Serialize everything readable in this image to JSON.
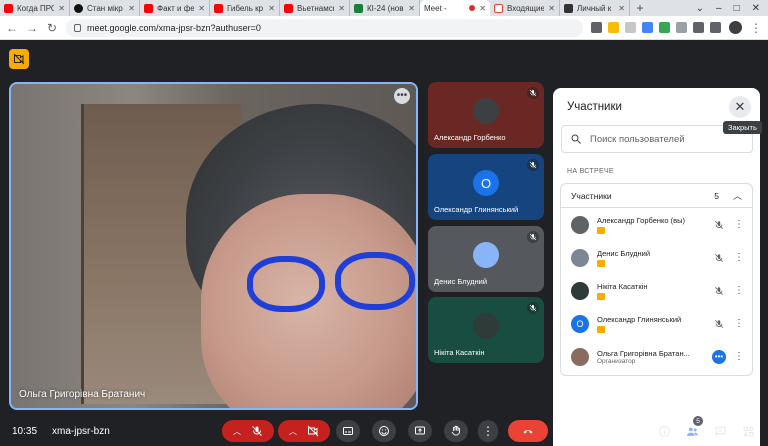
{
  "browser": {
    "tabs": [
      {
        "title": "Когда ПРО",
        "icon": "youtube-icon"
      },
      {
        "title": "Стан мікр",
        "icon": "github-icon"
      },
      {
        "title": "Факт и фе",
        "icon": "youtube-icon"
      },
      {
        "title": "Гибель кр",
        "icon": "youtube-icon"
      },
      {
        "title": "Вьетнамск",
        "icon": "youtube-icon"
      },
      {
        "title": "КІ-24 (нов",
        "icon": "sheets-icon"
      },
      {
        "title": "Meet -",
        "icon": "meet-icon",
        "active": true
      },
      {
        "title": "Входящие",
        "icon": "gmail-icon"
      },
      {
        "title": "Личный к",
        "icon": "notion-icon"
      }
    ],
    "url": "meet.google.com/xma-jpsr-bzn?authuser=0"
  },
  "main_tile": {
    "name": "Ольга Григорівна Братанич"
  },
  "side_tiles": [
    {
      "name": "Александр Горбенко",
      "avatar_letter": ""
    },
    {
      "name": "Олександр Глинянський",
      "avatar_letter": "O"
    },
    {
      "name": "Денис Блудний",
      "avatar_letter": ""
    },
    {
      "name": "Нікіта Касаткін",
      "avatar_letter": ""
    }
  ],
  "panel": {
    "title": "Участники",
    "close_tooltip": "Закрыть",
    "search_placeholder": "Поиск пользователей",
    "section_label": "НА ВСТРЕЧЕ",
    "group_label": "Участники",
    "group_count": "5",
    "participants": [
      {
        "name": "Александр Горбенко (вы)",
        "sub": "",
        "avatar_color": "#5f6368",
        "letter": ""
      },
      {
        "name": "Денис Блудний",
        "sub": "",
        "avatar_color": "#7b8794",
        "letter": ""
      },
      {
        "name": "Нікіта Касаткін",
        "sub": "",
        "avatar_color": "#2e3b38",
        "letter": ""
      },
      {
        "name": "Олександр Глинянський",
        "sub": "",
        "avatar_color": "#1a73e8",
        "letter": "O"
      },
      {
        "name": "Ольга Григорівна Братан...",
        "sub": "Организатор",
        "avatar_color": "#8a6b60",
        "letter": ""
      }
    ]
  },
  "bottom_bar": {
    "time": "10:35",
    "meeting_code": "xma-jpsr-bzn",
    "participants_count": "5"
  },
  "colors": {
    "accent_blue": "#8ab4f8",
    "end_call_red": "#ea4335",
    "muted_red": "#c5221f"
  }
}
